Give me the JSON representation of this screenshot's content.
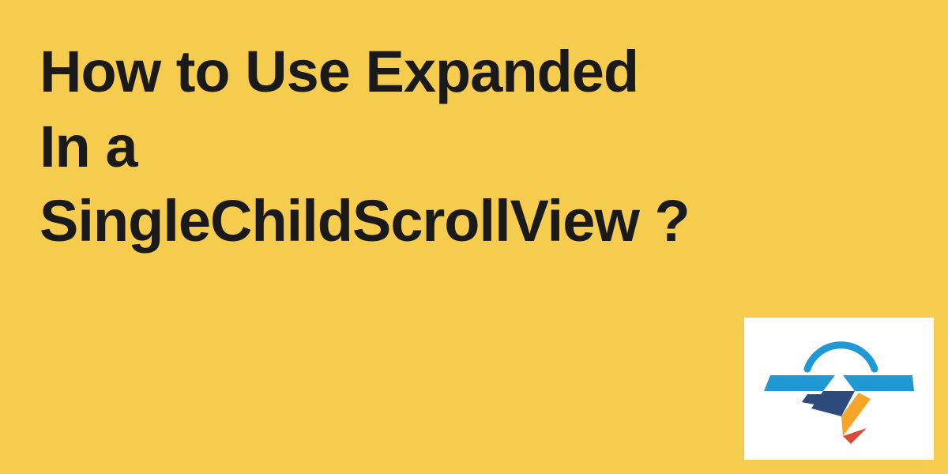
{
  "heading": {
    "line1": "How to Use Expanded",
    "line2": "In a",
    "line3": "SingleChildScrollView ?"
  },
  "colors": {
    "background": "#f6cc4e",
    "text": "#1a1a1a",
    "logo_card_bg": "#ffffff",
    "logo_blue": "#1f98d4",
    "logo_navy": "#2d4b7a",
    "logo_orange": "#f5a52a",
    "logo_red": "#d84a3a"
  }
}
